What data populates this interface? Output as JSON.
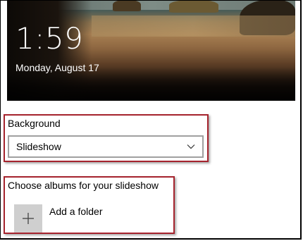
{
  "lock_screen_preview": {
    "time": "1:59",
    "date": "Monday, August 17"
  },
  "background": {
    "label": "Background",
    "selected": "Slideshow"
  },
  "albums": {
    "label": "Choose albums for your slideshow",
    "add_folder_label": "Add a folder"
  },
  "icons": {
    "dropdown": "chevron-down-icon",
    "add": "plus-icon"
  },
  "colors": {
    "highlight": "#a5232d",
    "plus_tile": "#cfcfcf"
  }
}
